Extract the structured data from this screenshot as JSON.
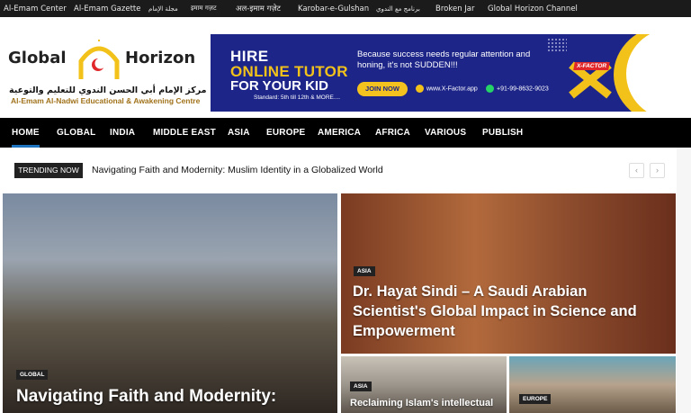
{
  "topbar": {
    "links": [
      "Al-Emam Center",
      "Al-Emam Gazette",
      "مجلة الإمام",
      "इमाम गज़ट",
      "अल-इमाम गज़ेट",
      "Karobar-e-Gulshan",
      "برنامج مع الندوي",
      "Broken Jar",
      "Global Horizon Channel"
    ]
  },
  "logo": {
    "left_word": "Global",
    "right_word": "Horizon",
    "arabic": "مركز الإمام أبي الحسن الندوي للتعليم والتوعية",
    "english": "Al-Emam Al-Nadwi Educational & Awakening Centre"
  },
  "banner": {
    "line1": "HIRE",
    "line2": "ONLINE TUTOR",
    "line3": "FOR YOUR KID",
    "standard": "Standard: 5th till 12th & MORE....",
    "message": "Because success needs regular attention and honing, it's not SUDDEN!!!",
    "cta": "JOIN NOW",
    "website": "www.X-Factor.app",
    "phone": "+91-99-8632-9023",
    "brand": "X-FACTOR"
  },
  "nav": {
    "items": [
      "HOME",
      "GLOBAL",
      "INDIA",
      "MIDDLE EAST",
      "ASIA",
      "EUROPE",
      "AMERICA",
      "AFRICA",
      "VARIOUS",
      "PUBLISH"
    ]
  },
  "trending": {
    "label": "TRENDING NOW",
    "headline": "Navigating Faith and Modernity: Muslim Identity in a Globalized World",
    "prev": "‹",
    "next": "›"
  },
  "cards": [
    {
      "category": "GLOBAL",
      "title": "Navigating Faith and Modernity:"
    },
    {
      "category": "ASIA",
      "title": "Dr. Hayat Sindi – A Saudi Arabian Scientist's Global Impact in Science and Empowerment"
    },
    {
      "category": "ASIA",
      "title": "Reclaiming Islam's intellectual"
    },
    {
      "category": "EUROPE",
      "title": ""
    }
  ],
  "colors": {
    "nav_bg": "#000000",
    "accent": "#1e73be",
    "banner_bg": "#1d2589",
    "banner_yellow": "#f2c21b"
  }
}
